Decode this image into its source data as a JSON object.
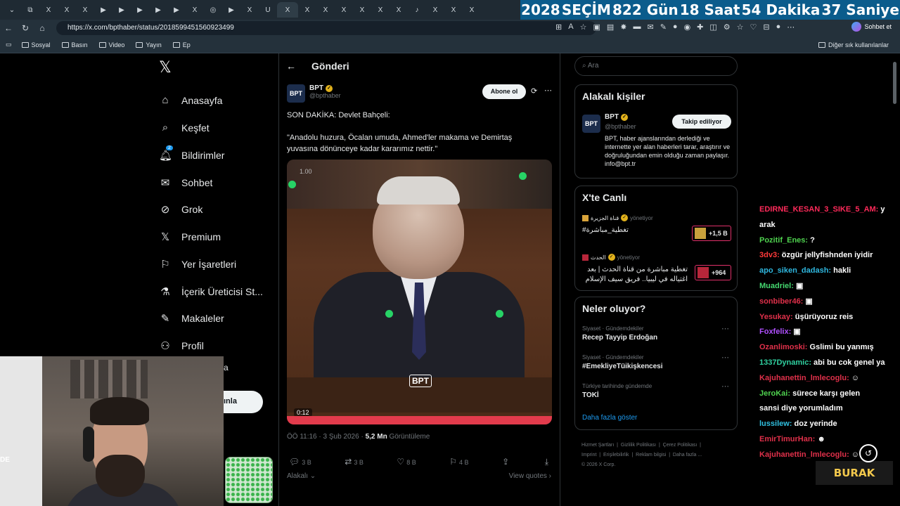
{
  "browser": {
    "tab_labels": [
      "X",
      "X",
      "X",
      "▶",
      "▶",
      "▶",
      "▶",
      "▶",
      "X",
      "◎",
      "▶",
      "X",
      "U",
      "X",
      "X",
      "X",
      "X",
      "X",
      "X",
      "X",
      "♪",
      "X",
      "X",
      "X"
    ],
    "ticker": {
      "year": "2028",
      "election": "SEÇİM",
      "days": "822 Gün",
      "hours": "18 Saat",
      "minutes": "54 Dakika",
      "seconds": "37 Saniye"
    },
    "url": "https://x.com/bpthaber/status/2018599451560923499",
    "chat_button": "Sohbet et",
    "bookmarks": [
      "Sosyal",
      "Basın",
      "Video",
      "Yayın",
      "Ep"
    ],
    "other_bookmarks": "Diğer sık kullanılanlar"
  },
  "sidebar": {
    "items": [
      {
        "label": "Anasayfa",
        "icon": "home-icon"
      },
      {
        "label": "Keşfet",
        "icon": "search-icon"
      },
      {
        "label": "Bildirimler",
        "icon": "bell-icon"
      },
      {
        "label": "Sohbet",
        "icon": "mail-icon"
      },
      {
        "label": "Grok",
        "icon": "grok-icon"
      },
      {
        "label": "Premium",
        "icon": "x-icon"
      },
      {
        "label": "Yer İşaretleri",
        "icon": "bookmark-icon"
      },
      {
        "label": "İçerik Üreticisi St...",
        "icon": "flask-icon"
      },
      {
        "label": "Makaleler",
        "icon": "article-icon"
      },
      {
        "label": "Profil",
        "icon": "person-icon"
      }
    ],
    "notif_badge": "2",
    "post_button_fragment": "ınla",
    "extra_fragment": "a"
  },
  "post": {
    "header_title": "Gönderi",
    "author_name": "BPT",
    "author_handle": "@bpthaber",
    "subscribe_label": "Abone ol",
    "text_line1": "SON DAKİKA: Devlet Bahçeli:",
    "text_line2": "\"Anadolu huzura, Öcalan umuda, Ahmed'ler makama ve Demirtaş",
    "text_line3": "yuvasına dönünceye kadar kararımız nettir.\"",
    "video_time": "0:12",
    "video_zoom": "1.00",
    "video_logo": "BPT",
    "date": "ÖÖ 11:16 · 3 Şub 2026 · ",
    "views": "5,2 Mn",
    "views_label": " Görüntüleme",
    "replies": "3 B",
    "reposts": "3 B",
    "likes": "8 B",
    "bookmarks": "4 B",
    "related_label": "Alakalı",
    "view_quotes": "View quotes"
  },
  "right": {
    "search_placeholder": "Ara",
    "related_people_title": "Alakalı kişiler",
    "person_name": "BPT",
    "person_handle": "@bpthaber",
    "following_label": "Takip ediliyor",
    "person_bio": "BPT, haber ajanslarından derlediği ve internette yer alan haberleri tarar, araştırır ve doğruluğundan emin olduğu zaman paylaşır. info@bpt.tr",
    "live_title": "X'te Canlı",
    "live1_host": "قناة الجزيرة",
    "live1_role": "yönetiyor",
    "live1_title": "#تغطية_مباشرة",
    "live1_count": "+1,5 B",
    "live2_host": "الحدث",
    "live2_role": "yönetiyor",
    "live2_title": "تغطية مباشرة من قناة الحدث | بعد اغتياله في ليبيا.. فريق سيف الإسلام",
    "live2_count": "+964",
    "trends_title": "Neler oluyor?",
    "trends": [
      {
        "category": "Siyaset · Gündemdekiler",
        "name": "Recep Tayyip Erdoğan"
      },
      {
        "category": "Siyaset · Gündemdekiler",
        "name": "#EmekliyeTüikişkencesi"
      },
      {
        "category": "Türkiye tarihinde gündemde",
        "name": "TOKİ"
      }
    ],
    "show_more": "Daha fazla göster",
    "footer_line1": "Hizmet Şartları  |  Gizlilik Politikası  |  Çerez Politikası  |",
    "footer_line2": "Imprint  |  Erişilebilirlik  |  Reklam bilgisi  |  Daha fazla ...",
    "footer_line3": "© 2026 X Corp."
  },
  "chat": [
    {
      "user": "EDIRNE_KESAN_3_SIKE_5_AM:",
      "msg": " y",
      "color": "#ff2a5a"
    },
    {
      "user": "",
      "msg": "arak",
      "color": "#ffffff"
    },
    {
      "user": "Pozitif_Enes:",
      "msg": " ?",
      "color": "#4fd34f"
    },
    {
      "user": "3dv3:",
      "msg": " özgür jellyfishnden iyidir",
      "color": "#ff3a3a"
    },
    {
      "user": "apo_siken_dadash:",
      "msg": " hakli",
      "color": "#2fb8e0"
    },
    {
      "user": "Muadriel:",
      "msg": " ▣",
      "color": "#45d870"
    },
    {
      "user": "sonbiber46:",
      "msg": " ▣",
      "color": "#e0304a"
    },
    {
      "user": "Yesukay:",
      "msg": " üşürüyoruz reis",
      "color": "#e0304a"
    },
    {
      "user": "Foxfelix:",
      "msg": " ▣",
      "color": "#b050ff"
    },
    {
      "user": "Ozanlimoski:",
      "msg": " Gslimi bu yanmış",
      "color": "#e0304a"
    },
    {
      "user": "1337Dynamic:",
      "msg": " abi bu cok genel ya",
      "color": "#30d0a0"
    },
    {
      "user": "Kajuhanettin_lmlecoglu:",
      "msg": " ☺",
      "color": "#e0304a"
    },
    {
      "user": "JeroKai:",
      "msg": " sürece karşı gelen",
      "color": "#4fd34f"
    },
    {
      "user": "",
      "msg": "sansi diye yorumladım",
      "color": "#ffffff"
    },
    {
      "user": "lussilew:",
      "msg": " doz yerinde",
      "color": "#30c0e0"
    },
    {
      "user": "EmirTimurHan:",
      "msg": " ☻",
      "color": "#e0304a"
    },
    {
      "user": "Kajuhanettin_lmlecoglu:",
      "msg": " ☺",
      "color": "#e0304a"
    }
  ],
  "overlay": {
    "badge": "BURAK",
    "cam_text": "DE"
  }
}
